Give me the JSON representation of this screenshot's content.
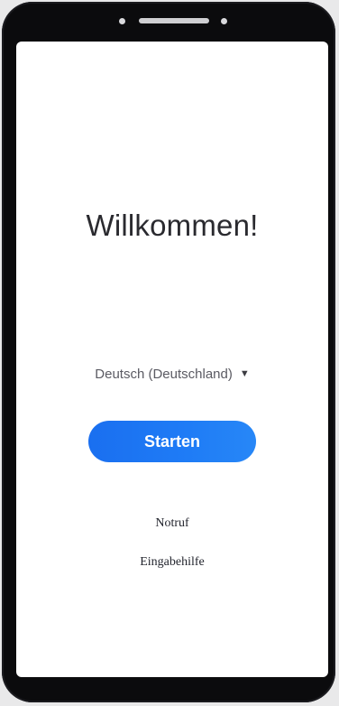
{
  "screen": {
    "title": "Willkommen!",
    "language_selector": {
      "value": "Deutsch (Deutschland)",
      "icon": "dropdown-triangle-icon"
    },
    "primary_button": {
      "label": "Starten"
    },
    "links": {
      "emergency": "Notruf",
      "accessibility": "Eingabehilfe"
    }
  },
  "colors": {
    "accent": "#1f7cf6",
    "background": "#ffffff",
    "device_frame": "#0b0b0d"
  }
}
